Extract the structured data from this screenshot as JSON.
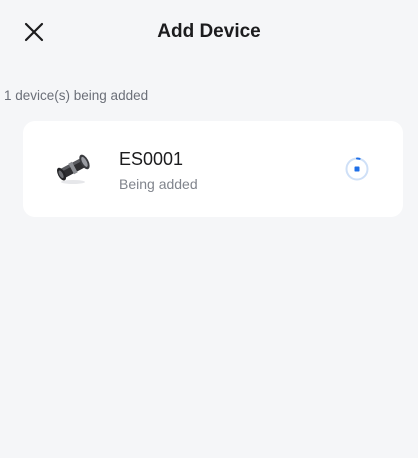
{
  "header": {
    "title": "Add Device",
    "close_icon": "close-icon"
  },
  "status": {
    "text": "1 device(s) being added"
  },
  "devices": [
    {
      "name": "ES0001",
      "status": "Being added",
      "image_icon": "smart-lock-icon",
      "progress_icon": "progress-stop-icon"
    }
  ],
  "colors": {
    "background": "#f5f6f8",
    "card": "#ffffff",
    "accent": "#1e6fe8",
    "ring": "#cfe0f7"
  }
}
